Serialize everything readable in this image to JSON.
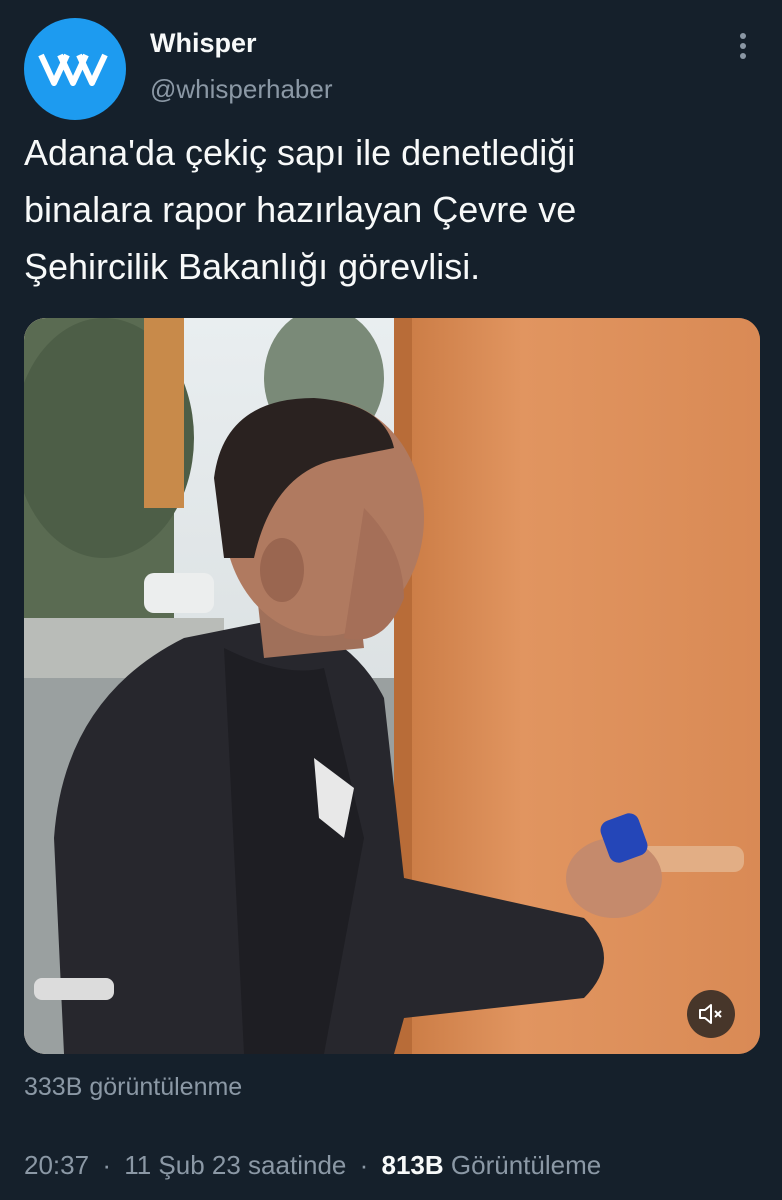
{
  "account": {
    "display_name": "Whisper",
    "handle": "@whisperhaber",
    "avatar_icon": "whisper-w-logo",
    "avatar_color": "#1d9bf0"
  },
  "tweet": {
    "text_lines": [
      "Adana'da çekiç sapı ile denetlediği",
      "binalara rapor hazırlayan Çevre ve",
      "Şehircilik Bakanlığı görevlisi."
    ]
  },
  "media": {
    "type": "video",
    "mute_icon": "speaker-muted-icon"
  },
  "stats": {
    "video_views": "333B görüntülenme",
    "time": "20:37",
    "date": "11 Şub 23 saatinde",
    "separator": "·",
    "views_count": "813B",
    "views_label": "Görüntüleme"
  },
  "colors": {
    "background": "#15202b",
    "text_primary": "#f7f9f9",
    "text_secondary": "#8b98a5",
    "accent": "#1d9bf0"
  },
  "icons": {
    "more": "more-dots-icon"
  }
}
